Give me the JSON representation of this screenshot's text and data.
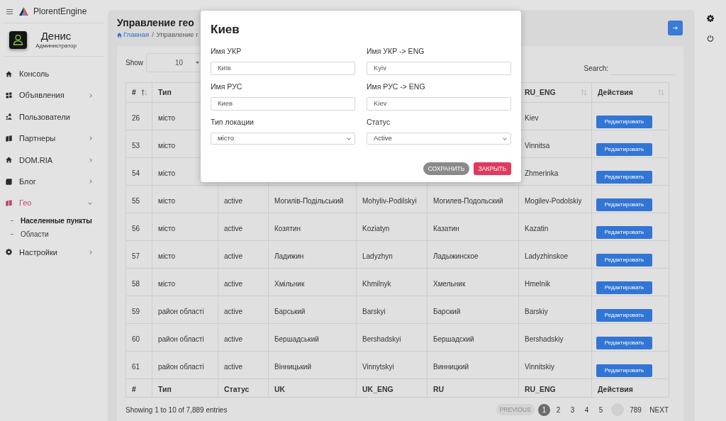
{
  "sidebar": {
    "brand": "PlorentEngine",
    "user": {
      "name": "Денис",
      "role": "Администратор"
    },
    "items": [
      {
        "label": "Консоль",
        "kind": "link",
        "selected": false
      },
      {
        "label": "Объявления",
        "kind": "group",
        "selected": false,
        "expanded": false
      },
      {
        "label": "Пользователи",
        "kind": "link",
        "selected": false
      },
      {
        "label": "Партнеры",
        "kind": "group",
        "selected": false,
        "expanded": false
      },
      {
        "label": "DOM.RIA",
        "kind": "group",
        "selected": false,
        "expanded": false
      },
      {
        "label": "Блог",
        "kind": "group",
        "selected": false,
        "expanded": false
      },
      {
        "label": "Гео",
        "kind": "group",
        "selected": true,
        "expanded": true,
        "children": [
          {
            "label": "Населенные пункты",
            "selected": true
          },
          {
            "label": "Области",
            "selected": false
          }
        ]
      },
      {
        "label": "Настройки",
        "kind": "group",
        "selected": false,
        "expanded": false
      }
    ]
  },
  "page": {
    "title": "Управление гео",
    "breadcrumb": {
      "items": [
        "Главная",
        "Управление г"
      ],
      "separator": "/"
    }
  },
  "table_controls": {
    "length": {
      "label": "Show",
      "value": "10"
    },
    "search": {
      "label": "Search:"
    }
  },
  "table": {
    "columns": [
      {
        "header": "#",
        "sorted": true,
        "footer": "#"
      },
      {
        "header": "Тип",
        "footer": "Тип"
      },
      {
        "footer": "Статус"
      },
      {
        "footer": "UK"
      },
      {
        "footer": "UK_ENG"
      },
      {
        "footer": "RU"
      },
      {
        "header": "RU_ENG",
        "sorted": false,
        "footer": "RU_ENG"
      },
      {
        "header": "Действия",
        "sorted": false,
        "footer": "Действия"
      }
    ],
    "rows": [
      {
        "number": "26",
        "type": "місто",
        "ru_eng": "Kiev",
        "action": "Редактировать"
      },
      {
        "number": "53",
        "type": "місто",
        "ru_eng": "Vinnitsa",
        "action": "Редактировать"
      },
      {
        "number": "54",
        "type": "місто",
        "ru_eng": "Zhmerinka",
        "action": "Редактировать"
      },
      {
        "number": "55",
        "type": "місто",
        "status": "active",
        "uk": "Могилів-Подільський",
        "uk_eng": "Mohyliv-Podilskyi",
        "ru": "Могилев-Подольский",
        "ru_eng": "Mogilev-Podolskiy",
        "action": "Редактировать"
      },
      {
        "number": "56",
        "type": "місто",
        "status": "active",
        "uk": "Козятин",
        "uk_eng": "Koziatyn",
        "ru": "Казатин",
        "ru_eng": "Kazatin",
        "action": "Редактировать"
      },
      {
        "number": "57",
        "type": "місто",
        "status": "active",
        "uk": "Ладижин",
        "uk_eng": "Ladyzhyn",
        "ru": "Ладыжинское",
        "ru_eng": "Ladyzhinskoe",
        "action": "Редактировать"
      },
      {
        "number": "58",
        "type": "місто",
        "status": "active",
        "uk": "Хмільник",
        "uk_eng": "Khmilnyk",
        "ru": "Хмельник",
        "ru_eng": "Hmelnik",
        "action": "Редактировать"
      },
      {
        "number": "59",
        "type": "район області",
        "status": "active",
        "uk": "Барський",
        "uk_eng": "Barskyi",
        "ru": "Барский",
        "ru_eng": "Barskiy",
        "action": "Редактировать"
      },
      {
        "number": "60",
        "type": "район області",
        "status": "active",
        "uk": "Бершадський",
        "uk_eng": "Bershadskyi",
        "ru": "Бершадский",
        "ru_eng": "Bershadskiy",
        "action": "Редактировать"
      },
      {
        "number": "61",
        "type": "район області",
        "status": "active",
        "uk": "Вінницький",
        "uk_eng": "Vinnytskyi",
        "ru": "Винницкий",
        "ru_eng": "Vinnitskiy",
        "action": "Редактировать"
      }
    ]
  },
  "info": "Showing 1 to 10 of 7,889 entries",
  "pagination": {
    "previous": {
      "label": "PREVIOUS",
      "disabled": true
    },
    "pages": [
      {
        "kind": "page",
        "label": "1",
        "selected": true
      },
      {
        "kind": "page",
        "label": "2",
        "selected": false
      },
      {
        "kind": "page",
        "label": "3",
        "selected": false
      },
      {
        "kind": "page",
        "label": "4",
        "selected": false
      },
      {
        "kind": "page",
        "label": "5",
        "selected": false
      },
      {
        "kind": "gap",
        "selected": false
      },
      {
        "kind": "page",
        "label": "789",
        "selected": false
      }
    ],
    "next": {
      "label": "NEXT",
      "disabled": false
    }
  },
  "modal": {
    "title": "Киев",
    "fields": [
      {
        "label": "Имя УКР",
        "kind": "text",
        "value": "Київ"
      },
      {
        "label": "Имя УКР -> ENG",
        "kind": "text",
        "value": "Kyiv"
      },
      {
        "label": "Имя РУС",
        "kind": "text",
        "value": "Киев"
      },
      {
        "label": "Имя РУС -> ENG",
        "kind": "text",
        "value": "Kiev"
      },
      {
        "label": "Тип локации",
        "kind": "select",
        "value": "місто"
      },
      {
        "label": "Статус",
        "kind": "select",
        "value": "Active"
      }
    ],
    "buttons": [
      {
        "label": "СОХРАНИТЬ",
        "kind": "secondary"
      },
      {
        "label": "ЗАКРЫТЬ",
        "kind": "danger"
      }
    ]
  }
}
